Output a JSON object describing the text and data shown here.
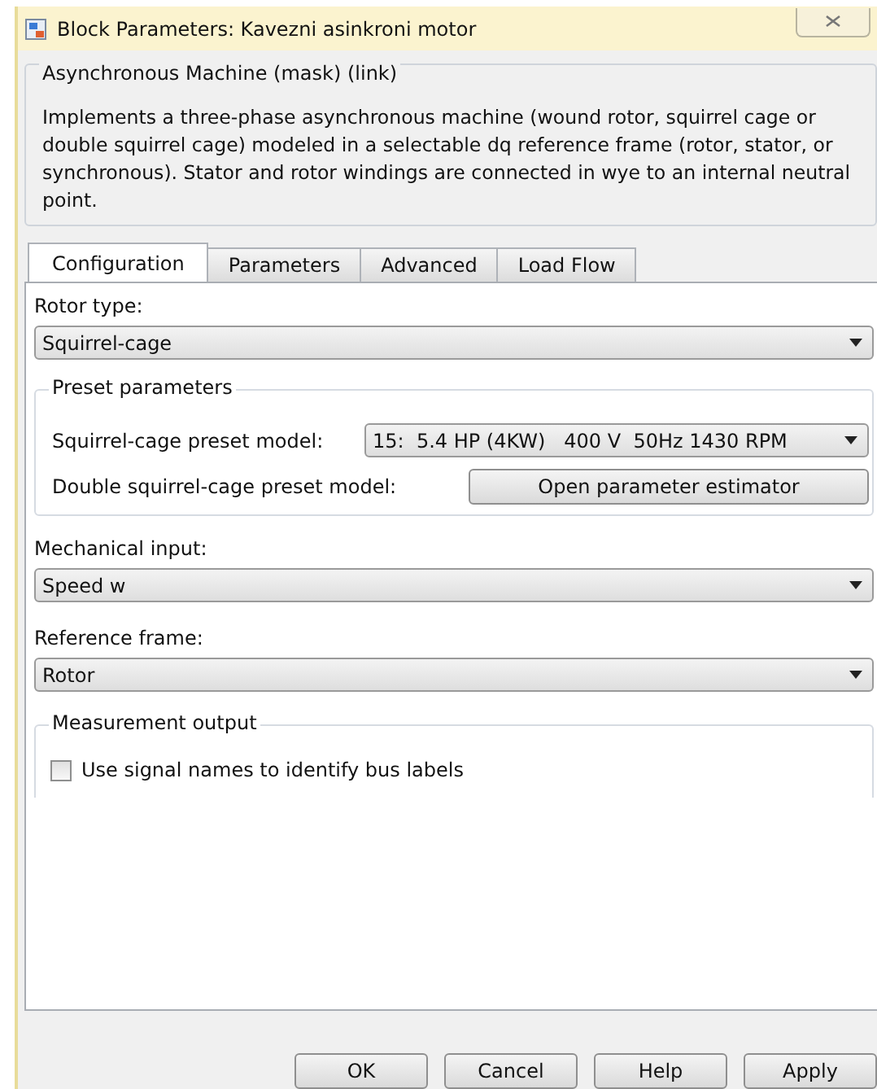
{
  "window": {
    "title": "Block Parameters: Kavezni asinkroni motor"
  },
  "description": {
    "title": "Asynchronous Machine (mask) (link)",
    "text": "Implements a three-phase asynchronous machine (wound rotor, squirrel cage or double squirrel cage) modeled in a selectable dq reference frame (rotor, stator, or synchronous). Stator and rotor windings are connected in wye to an internal neutral point."
  },
  "tabs": [
    {
      "label": "Configuration",
      "selected": true
    },
    {
      "label": "Parameters",
      "selected": false
    },
    {
      "label": "Advanced",
      "selected": false
    },
    {
      "label": "Load Flow",
      "selected": false
    }
  ],
  "rotor_type": {
    "label": "Rotor type:",
    "value": "Squirrel-cage"
  },
  "preset_parameters": {
    "title": "Preset parameters",
    "squirrel_label": "Squirrel-cage preset model:",
    "squirrel_value": "15:  5.4 HP (4KW)   400 V  50Hz 1430 RPM",
    "double_label": "Double squirrel-cage preset model:",
    "estimator_button": "Open parameter estimator"
  },
  "mechanical_input": {
    "label": "Mechanical input:",
    "value": "Speed w"
  },
  "reference_frame": {
    "label": "Reference frame:",
    "value": "Rotor"
  },
  "measurement_output": {
    "title": "Measurement output",
    "checkbox_label": "Use signal names to identify bus labels",
    "checked": false
  },
  "buttons": [
    "OK",
    "Cancel",
    "Help",
    "Apply"
  ]
}
